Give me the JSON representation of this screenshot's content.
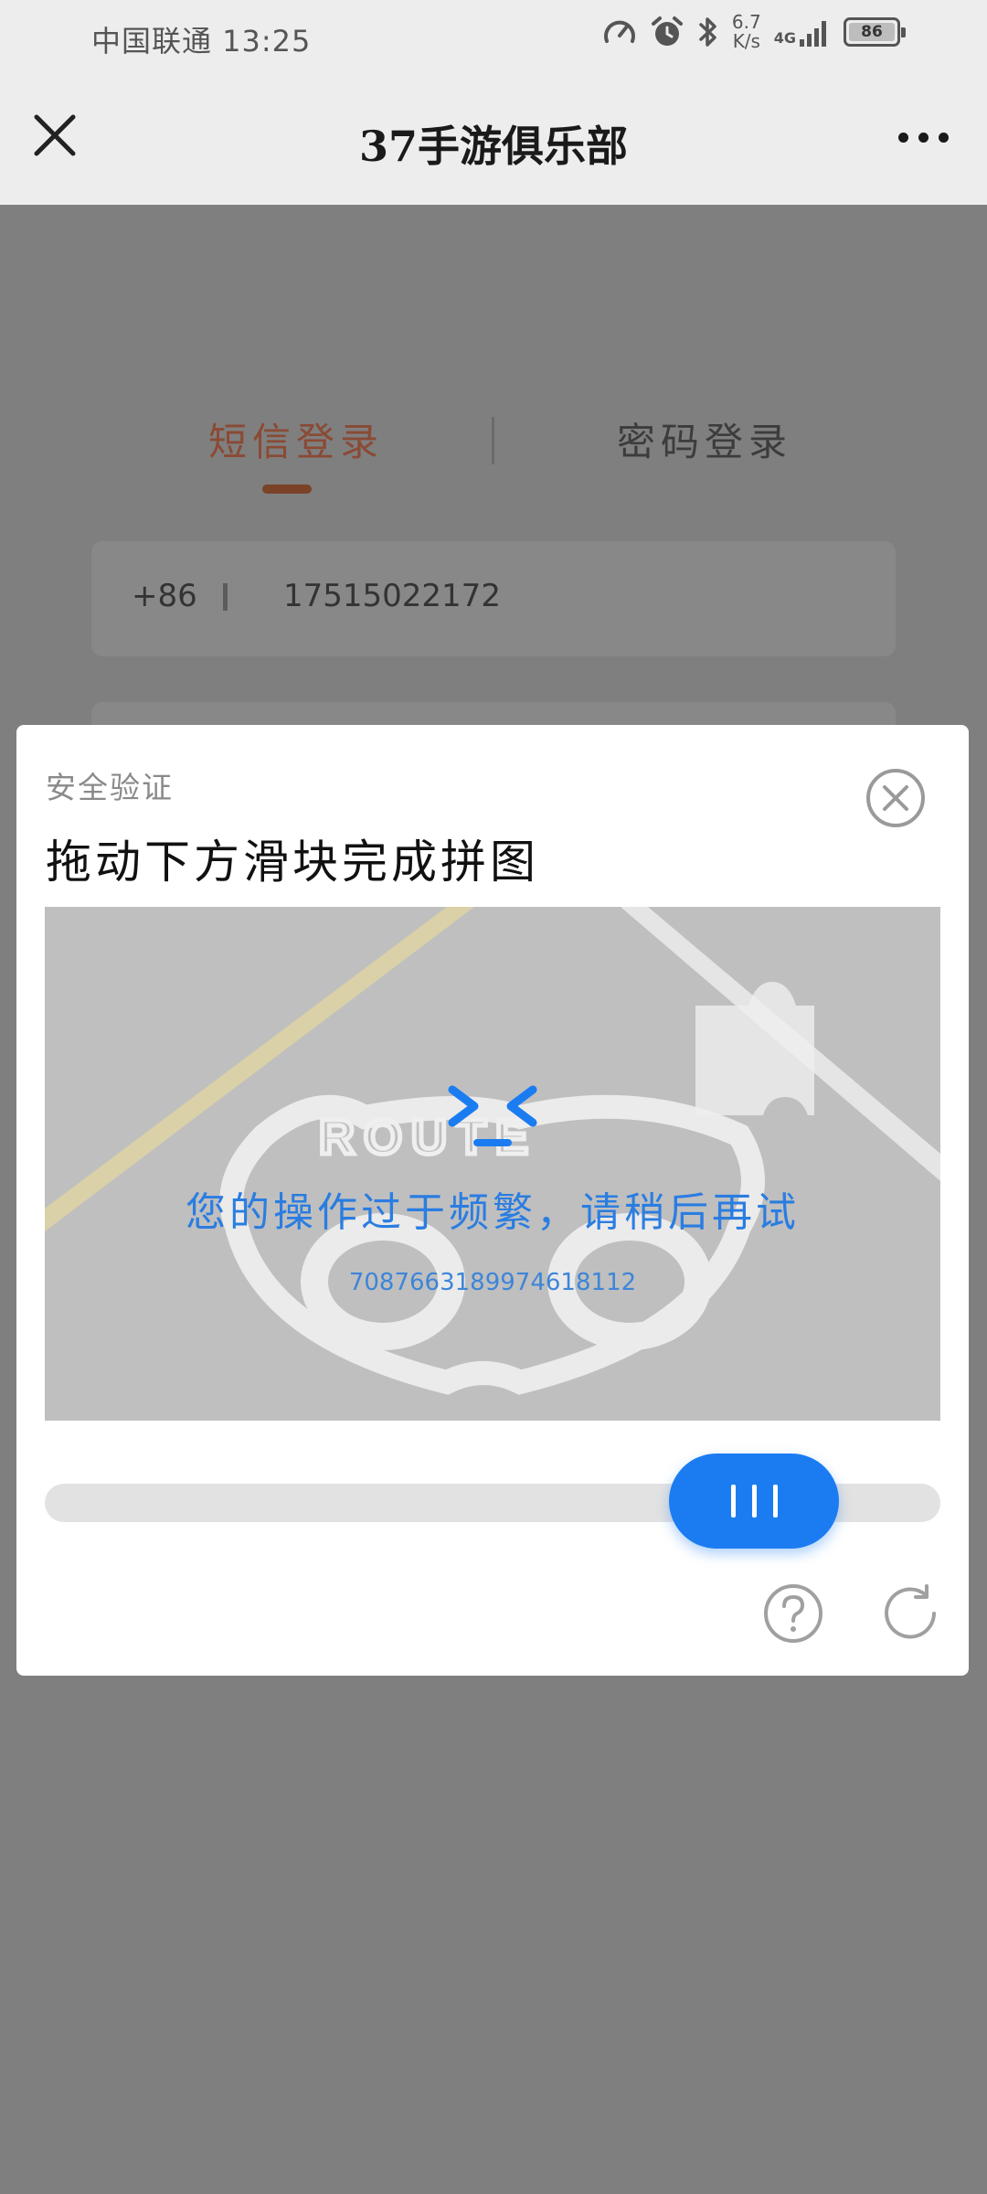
{
  "status_bar": {
    "carrier_time": "中国联通 13:25",
    "net_speed_value": "6.7",
    "net_speed_unit": "K/s",
    "network": "4G",
    "battery": "86",
    "icons": [
      "speedometer-icon",
      "alarm-icon",
      "bluetooth-icon",
      "signal-icon",
      "battery-icon"
    ]
  },
  "title_bar": {
    "title": "37手游俱乐部",
    "close_icon": "close-icon",
    "more_icon": "more-dots-icon"
  },
  "login": {
    "tabs": [
      {
        "label": "短信登录",
        "active": true
      },
      {
        "label": "密码登录",
        "active": false
      }
    ],
    "country_code": "+86",
    "phone": "17515022172"
  },
  "verify_modal": {
    "subtitle": "安全验证",
    "title": "拖动下方滑块完成拼图",
    "error_message": "您的操作过于频繁，请稍后再试",
    "error_code": "7087663189974618112",
    "icons": [
      "close-circle-icon",
      "face-icon",
      "slider-grip-icon",
      "help-icon",
      "refresh-icon"
    ]
  },
  "colors": {
    "accent_blue": "#1b7cf2",
    "active_tab": "#8a4a34",
    "dim_overlay": "#7f7f7f"
  }
}
